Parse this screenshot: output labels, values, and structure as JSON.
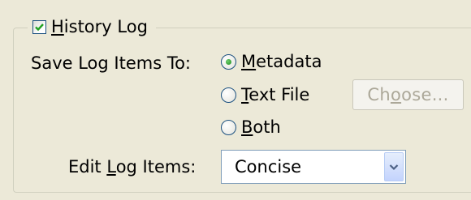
{
  "group": {
    "title_pre": "",
    "title_mnemonic": "H",
    "title_post": "istory Log",
    "checked": true
  },
  "save_to": {
    "label": "Save Log Items To:",
    "options": [
      {
        "pre": "",
        "mnemonic": "M",
        "post": "etadata",
        "selected": true
      },
      {
        "pre": "",
        "mnemonic": "T",
        "post": "ext File",
        "selected": false
      },
      {
        "pre": "",
        "mnemonic": "B",
        "post": "oth",
        "selected": false
      }
    ],
    "choose_button": {
      "pre": "Ch",
      "mnemonic": "o",
      "post": "ose...",
      "enabled": false
    }
  },
  "edit": {
    "label_pre": "Edit ",
    "label_mnemonic": "L",
    "label_post": "og Items:",
    "value": "Concise"
  },
  "colors": {
    "check": "#21a121",
    "radio_dot": "#1f8a1f",
    "dropdown_arrow": "#4d6185"
  }
}
